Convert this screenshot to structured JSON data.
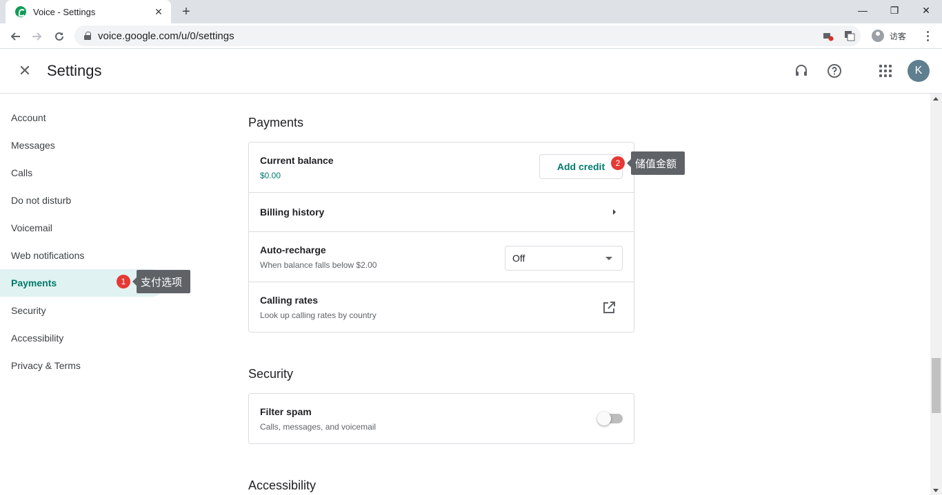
{
  "browser": {
    "tab_title": "Voice - Settings",
    "tab_close": "✕",
    "new_tab": "+",
    "url": "voice.google.com/u/0/settings",
    "profile_label": "访客",
    "window_controls": {
      "minimize": "—",
      "restore": "❐",
      "close": "✕"
    }
  },
  "header": {
    "close": "✕",
    "title": "Settings",
    "avatar_letter": "K"
  },
  "sidebar": {
    "items": [
      {
        "label": "Account"
      },
      {
        "label": "Messages"
      },
      {
        "label": "Calls"
      },
      {
        "label": "Do not disturb"
      },
      {
        "label": "Voicemail"
      },
      {
        "label": "Web notifications"
      },
      {
        "label": "Payments",
        "active": true
      },
      {
        "label": "Security"
      },
      {
        "label": "Accessibility"
      },
      {
        "label": "Privacy & Terms"
      }
    ]
  },
  "annotations": [
    {
      "number": "1",
      "text": "支付选项"
    },
    {
      "number": "2",
      "text": "储值金额"
    }
  ],
  "payments": {
    "title": "Payments",
    "current_balance": {
      "label": "Current balance",
      "value": "$0.00",
      "button": "Add credit"
    },
    "billing_history": {
      "label": "Billing history"
    },
    "auto_recharge": {
      "label": "Auto-recharge",
      "sub": "When balance falls below $2.00",
      "selected": "Off"
    },
    "calling_rates": {
      "label": "Calling rates",
      "sub": "Look up calling rates by country"
    }
  },
  "security": {
    "title": "Security",
    "filter_spam": {
      "label": "Filter spam",
      "sub": "Calls, messages, and voicemail",
      "enabled": false
    }
  },
  "accessibility": {
    "title": "Accessibility"
  },
  "colors": {
    "accent": "#00796b",
    "active_bg": "#e0f2f1",
    "badge": "#e53935",
    "tooltip": "#5f6368"
  }
}
